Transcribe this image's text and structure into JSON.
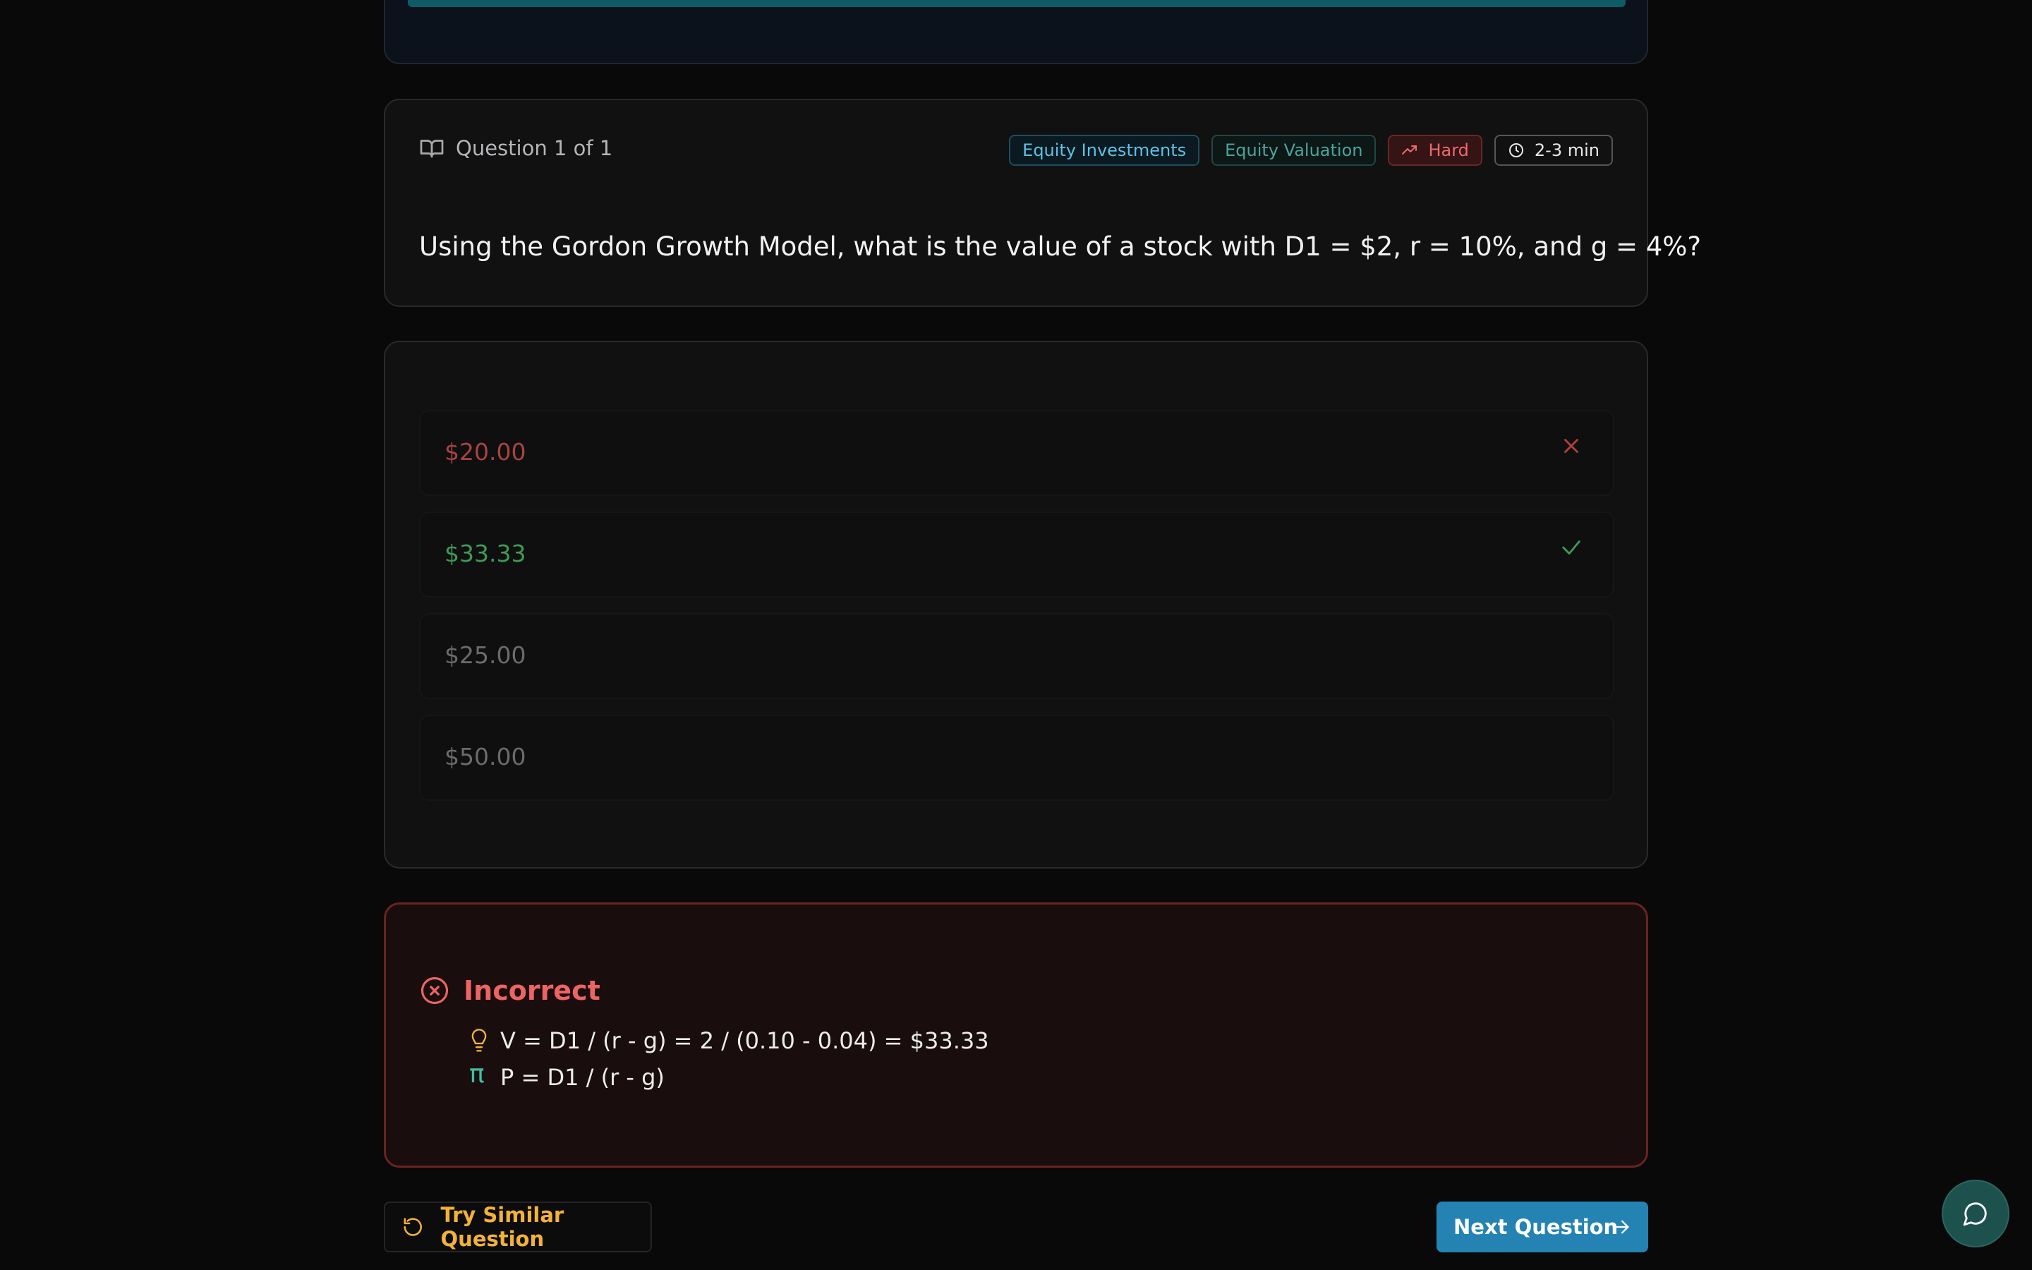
{
  "question": {
    "counter": "Question 1 of 1",
    "text": "Using the Gordon Growth Model, what is the value of a stock with D1 = $2, r = 10%, and g = 4%?",
    "tags": {
      "topic": "Equity Investments",
      "subtopic": "Equity Valuation",
      "difficulty": "Hard",
      "time": "2-3 min"
    }
  },
  "options": [
    {
      "label": "$20.00",
      "state": "wrong",
      "icon": "x-icon"
    },
    {
      "label": "$33.33",
      "state": "correct",
      "icon": "check-icon"
    },
    {
      "label": "$25.00",
      "state": "neutral"
    },
    {
      "label": "$50.00",
      "state": "neutral"
    }
  ],
  "feedback": {
    "status": "Incorrect",
    "explanation": "V = D1 / (r - g) = 2 / (0.10 - 0.04) = $33.33",
    "formula_symbol": "π",
    "formula": "P = D1 / (r - g)"
  },
  "actions": {
    "try_similar": "Try Similar Question",
    "next": "Next Question"
  },
  "colors": {
    "accent": "#2483b2",
    "incorrect": "#ec6464",
    "correct": "#3f9a55",
    "warning": "#f3b13a"
  }
}
